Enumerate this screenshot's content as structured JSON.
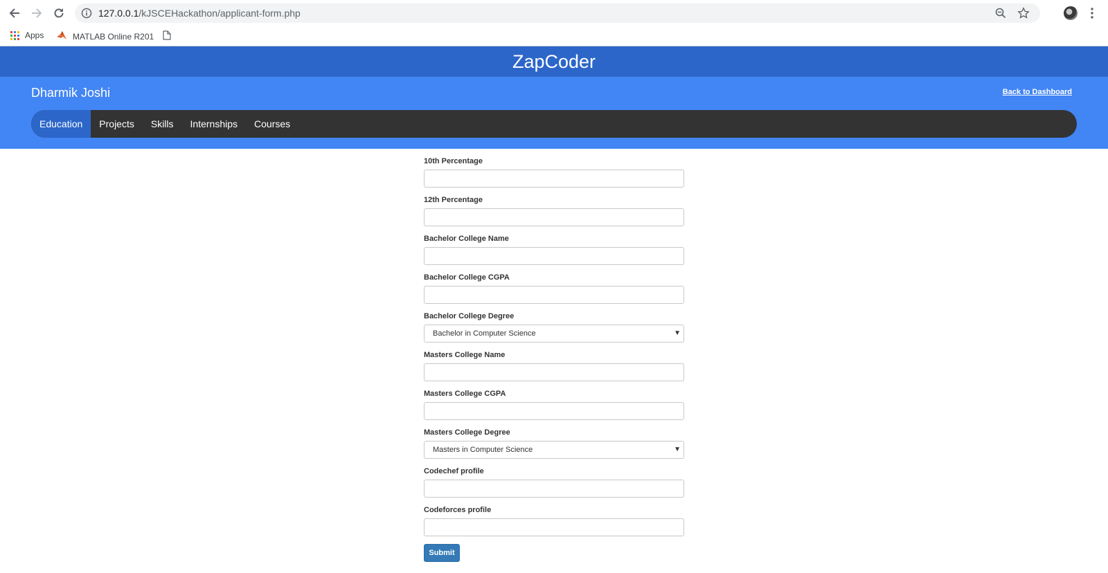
{
  "browser": {
    "url_host": "127.0.0.1",
    "url_path": "/kJSCEHackathon/applicant-form.php",
    "bookmarks": [
      {
        "label": "Apps"
      },
      {
        "label": "MATLAB Online R201"
      }
    ]
  },
  "header": {
    "brand": "ZapCoder",
    "username": "Dharmik Joshi",
    "back_link": "Back to Dashboard"
  },
  "tabs": [
    {
      "label": "Education"
    },
    {
      "label": "Projects"
    },
    {
      "label": "Skills"
    },
    {
      "label": "Internships"
    },
    {
      "label": "Courses"
    }
  ],
  "form": {
    "tenth_label": "10th Percentage",
    "twelfth_label": "12th Percentage",
    "bachelor_name_label": "Bachelor College Name",
    "bachelor_cgpa_label": "Bachelor College CGPA",
    "bachelor_degree_label": "Bachelor College Degree",
    "bachelor_degree_value": "Bachelor in Computer Science",
    "masters_name_label": "Masters College Name",
    "masters_cgpa_label": "Masters College CGPA",
    "masters_degree_label": "Masters College Degree",
    "masters_degree_value": "Masters in Computer Science",
    "codechef_label": "Codechef profile",
    "codeforces_label": "Codeforces profile",
    "submit_label": "Submit"
  },
  "colors": {
    "brandbar": "#2c66c9",
    "userbar": "#4285f4",
    "tabbar": "#333333",
    "submit": "#337ab7"
  }
}
